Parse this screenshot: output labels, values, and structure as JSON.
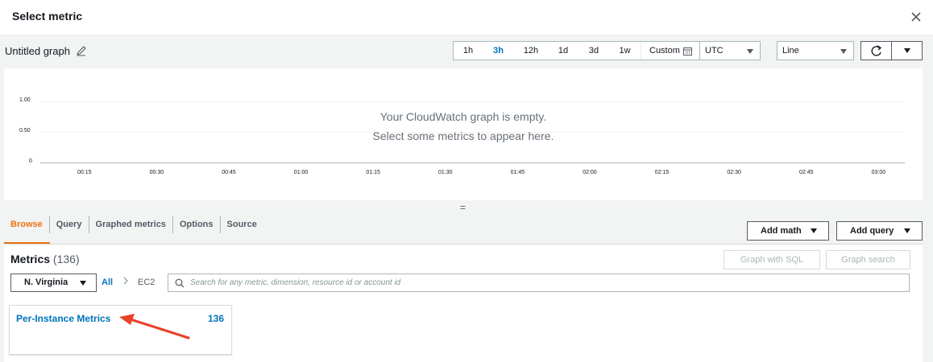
{
  "modal": {
    "title": "Select metric"
  },
  "graph": {
    "title": "Untitled graph",
    "time_ranges": [
      {
        "label": "1h",
        "active": false
      },
      {
        "label": "3h",
        "active": true
      },
      {
        "label": "12h",
        "active": false
      },
      {
        "label": "1d",
        "active": false
      },
      {
        "label": "3d",
        "active": false
      },
      {
        "label": "1w",
        "active": false
      }
    ],
    "custom_label": "Custom",
    "timezone": "UTC",
    "chart_type": "Line",
    "empty_line1": "Your CloudWatch graph is empty.",
    "empty_line2": "Select some metrics to appear here.",
    "y_ticks": [
      "1.00",
      "0.50",
      "0"
    ],
    "x_ticks": [
      "00:15",
      "00:30",
      "00:45",
      "01:00",
      "01:15",
      "01:30",
      "01:45",
      "02:00",
      "02:15",
      "02:30",
      "02:45",
      "03:00"
    ]
  },
  "tabs": [
    {
      "label": "Browse",
      "active": true
    },
    {
      "label": "Query",
      "active": false
    },
    {
      "label": "Graphed metrics",
      "active": false
    },
    {
      "label": "Options",
      "active": false
    },
    {
      "label": "Source",
      "active": false
    }
  ],
  "actions": {
    "add_math": "Add math",
    "add_query": "Add query"
  },
  "metrics": {
    "heading": "Metrics",
    "count": "(136)",
    "graph_with_sql": "Graph with SQL",
    "graph_search": "Graph search",
    "region": "N. Virginia",
    "crumb_all": "All",
    "crumb_namespace": "EC2",
    "search_placeholder": "Search for any metric, dimension, resource id or account id",
    "cards": [
      {
        "title": "Per-Instance Metrics",
        "count": "136"
      }
    ]
  },
  "colors": {
    "accent_blue": "#0073bb",
    "accent_orange": "#ec7211",
    "annotation_arrow": "#e8432a"
  }
}
